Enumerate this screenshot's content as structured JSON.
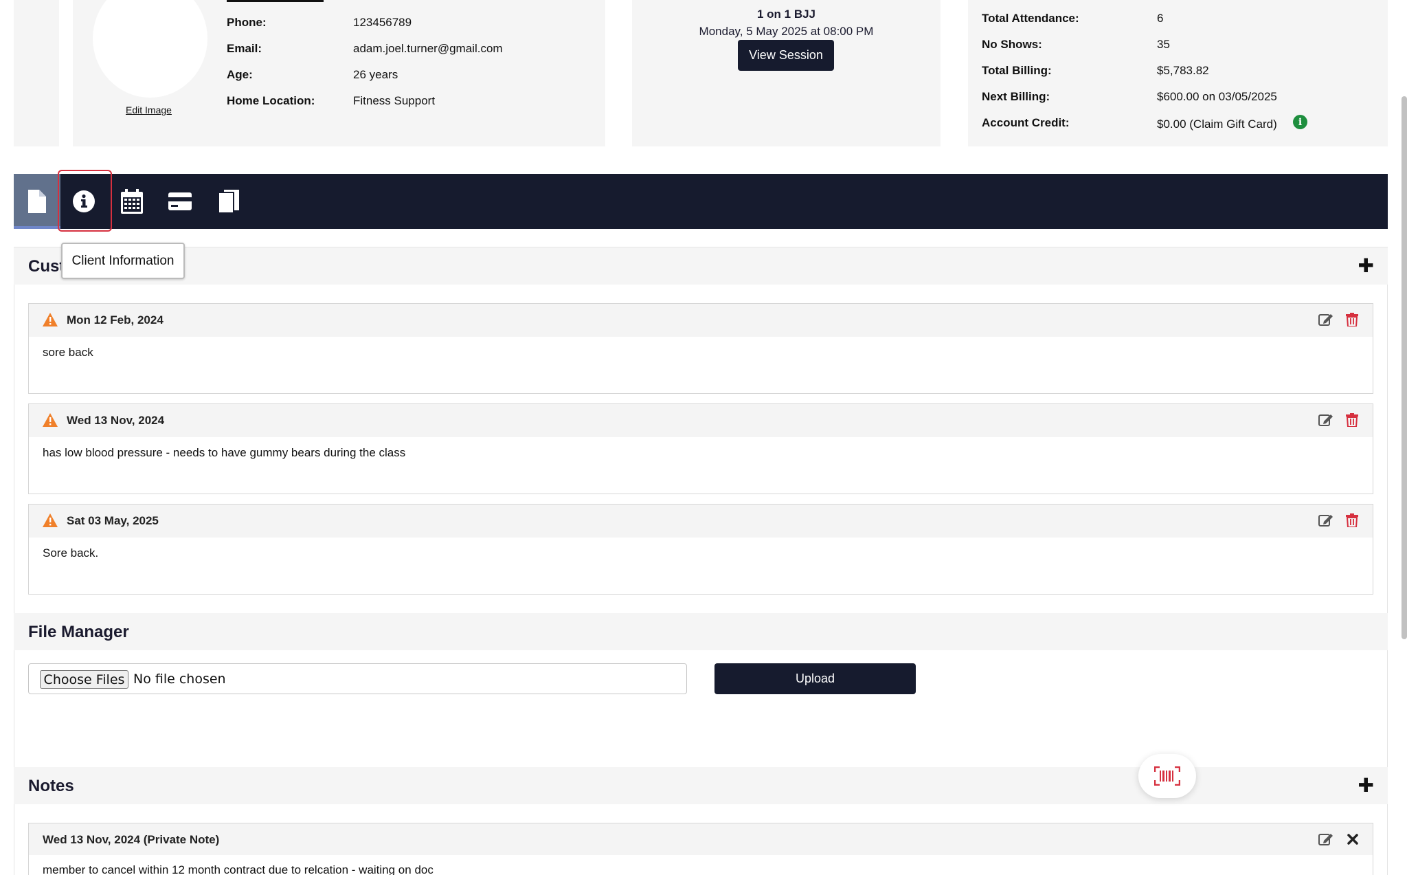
{
  "profile": {
    "fields": [
      {
        "label": "Phone:",
        "value": "123456789"
      },
      {
        "label": "Email:",
        "value": "adam.joel.turner@gmail.com"
      },
      {
        "label": "Age:",
        "value": "26 years"
      },
      {
        "label": "Home Location:",
        "value": "Fitness Support"
      }
    ],
    "edit_image_label": "Edit Image"
  },
  "session": {
    "title": "1 on 1 BJJ",
    "date": "Monday, 5 May 2025 at 08:00 PM",
    "view_button": "View Session"
  },
  "stats": [
    {
      "label": "Total Attendance:",
      "value": "6"
    },
    {
      "label": "No Shows:",
      "value": "35"
    },
    {
      "label": "Total Billing:",
      "value": "$5,783.82"
    },
    {
      "label": "Next Billing:",
      "value": "$600.00 on 03/05/2025"
    },
    {
      "label": "Account Credit:",
      "value": "$0.00 (Claim Gift Card)"
    }
  ],
  "tabs": [
    {
      "icon": "document-icon",
      "active": true
    },
    {
      "icon": "info-icon",
      "active": false
    },
    {
      "icon": "calendar-icon",
      "active": false
    },
    {
      "icon": "credit-card-icon",
      "active": false
    },
    {
      "icon": "book-icon",
      "active": false
    }
  ],
  "tooltip": "Client Information",
  "custom_section": {
    "title_visible": "Cust",
    "notes": [
      {
        "date": "Mon 12 Feb, 2024",
        "text": "sore back"
      },
      {
        "date": "Wed 13 Nov, 2024",
        "text": "has low blood pressure - needs to have gummy bears during the class"
      },
      {
        "date": "Sat 03 May, 2025",
        "text": "Sore back."
      }
    ]
  },
  "file_manager": {
    "title": "File Manager",
    "choose_label": "Choose Files",
    "no_file_label": "No file chosen",
    "upload_label": "Upload"
  },
  "notes_section": {
    "title": "Notes",
    "notes": [
      {
        "header": "Wed 13 Nov, 2024 (Private Note)",
        "text": "member to cancel within 12 month contract due to relcation - waiting on doc"
      }
    ]
  },
  "colors": {
    "navy": "#161b2e",
    "warning": "#f0802a",
    "delete": "#d6303f",
    "info_green": "#1e8e3e"
  }
}
